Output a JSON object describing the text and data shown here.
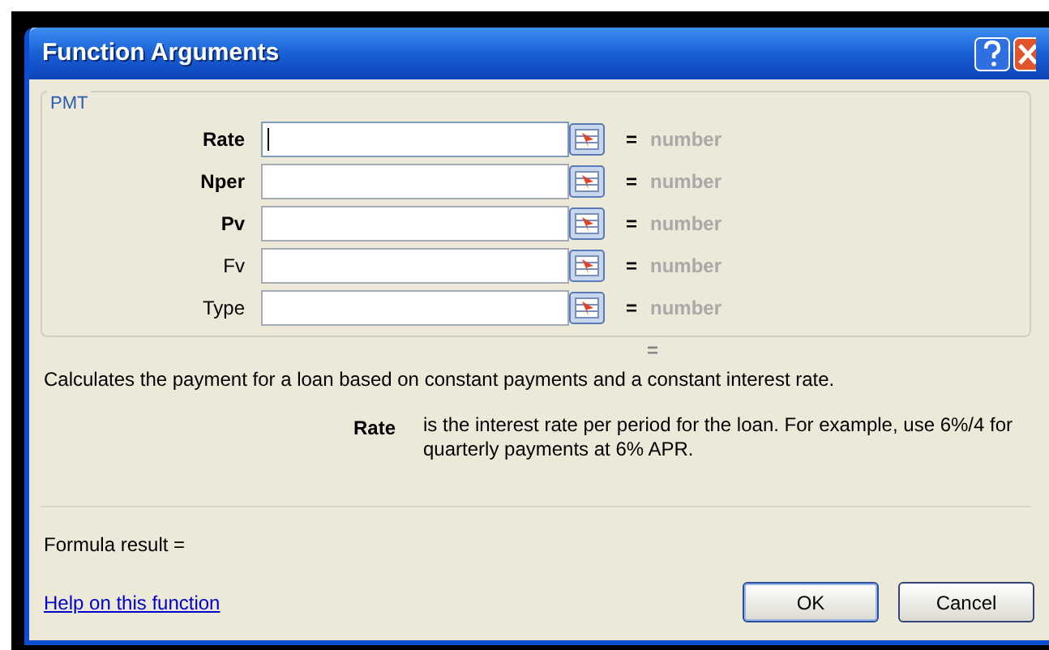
{
  "window": {
    "title": "Function Arguments"
  },
  "group": {
    "legend": "PMT"
  },
  "arguments": [
    {
      "label": "Rate",
      "required": true,
      "focused": true,
      "equals": "=",
      "result": "number"
    },
    {
      "label": "Nper",
      "required": true,
      "focused": false,
      "equals": "=",
      "result": "number"
    },
    {
      "label": "Pv",
      "required": true,
      "focused": false,
      "equals": "=",
      "result": "number"
    },
    {
      "label": "Fv",
      "required": false,
      "focused": false,
      "equals": "=",
      "result": "number"
    },
    {
      "label": "Type",
      "required": false,
      "focused": false,
      "equals": "=",
      "result": "number"
    }
  ],
  "function_result": "=",
  "description": "Calculates the payment for a loan based on constant payments and a constant interest rate.",
  "argument_help": {
    "name": "Rate",
    "text": "is the interest rate per period for the loan. For example, use 6%/4 for quarterly payments at 6% APR."
  },
  "formula_result": "Formula result =",
  "help_link": "Help on this function",
  "buttons": [
    "OK",
    "Cancel"
  ]
}
